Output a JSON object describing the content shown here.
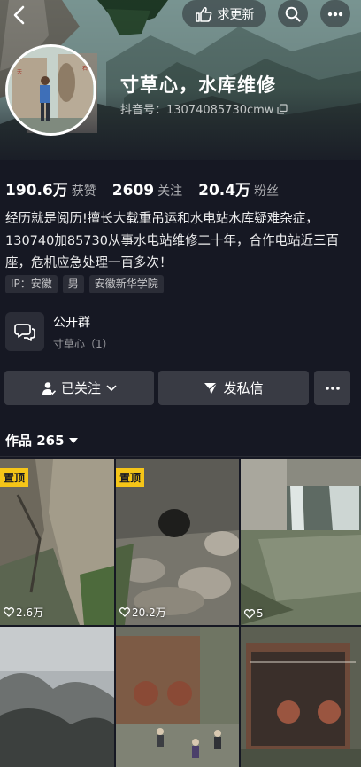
{
  "header": {
    "update_label": "求更新",
    "nickname": "寸草心，水库维修",
    "douyin_id": "抖音号：13074085730cmw"
  },
  "stats": [
    {
      "value": "190.6万",
      "label": "获赞"
    },
    {
      "value": "2609",
      "label": "关注"
    },
    {
      "value": "20.4万",
      "label": "粉丝"
    }
  ],
  "bio": {
    "line1": "经历就是阅历!擅长大载重吊运和水电站水库疑难杂症，",
    "line2": "130740加85730从事水电站维修二十年，合作电站近三百",
    "line3": "座，危机应急处理一百多次！"
  },
  "tags": [
    "IP：安徽",
    "男",
    "安徽新华学院"
  ],
  "group": {
    "title": "公开群",
    "subtitle": "寸草心（1）"
  },
  "actions": {
    "follow_label": "已关注",
    "message_label": "发私信"
  },
  "works": {
    "label": "作品 265"
  },
  "videos": [
    {
      "pinned": true,
      "pin_label": "置顶",
      "likes": "2.6万"
    },
    {
      "pinned": true,
      "pin_label": "置顶",
      "likes": "20.2万"
    },
    {
      "pinned": false,
      "likes": "5"
    },
    {
      "pinned": false,
      "likes": ""
    },
    {
      "pinned": false,
      "likes": ""
    },
    {
      "pinned": false,
      "likes": ""
    }
  ],
  "colors": {
    "background": "#161823",
    "button": "#393b44",
    "pin": "#f5c518"
  }
}
